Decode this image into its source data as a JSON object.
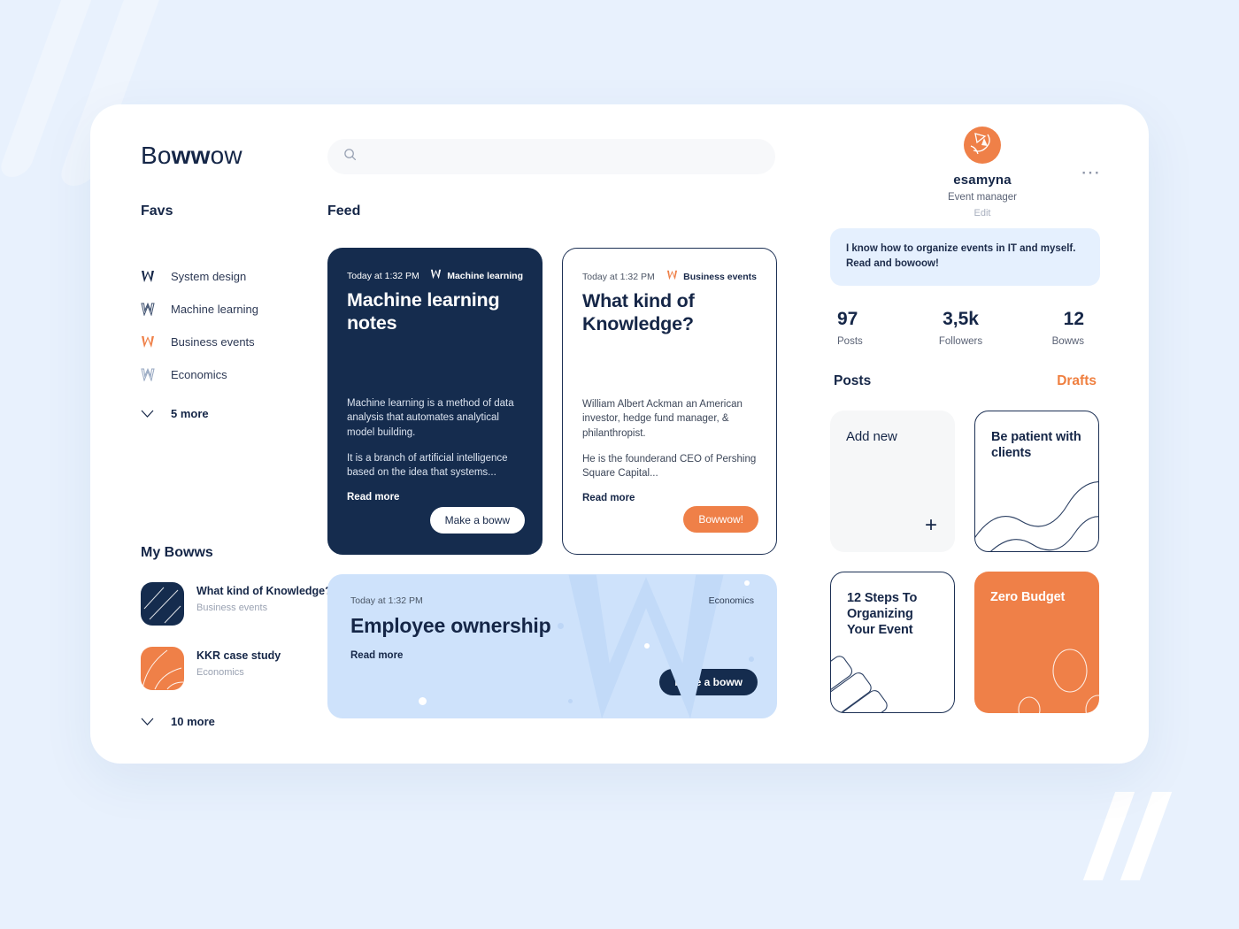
{
  "brand": {
    "name_prefix": "Bo",
    "name_bold": "ww",
    "name_suffix": "ow"
  },
  "search": {
    "value": "",
    "placeholder": "",
    "icon": "search-icon"
  },
  "header": {
    "overflow_icon": "more-horizontal-icon"
  },
  "profile": {
    "avatar_icon": "user-avatar",
    "username": "esamyna",
    "role": "Event manager",
    "edit_label": "Edit",
    "bio": "I know how to organize events in IT and myself. Read and bowoow!",
    "stats": [
      {
        "value": "97",
        "label": "Posts"
      },
      {
        "value": "3,5k",
        "label": "Followers"
      },
      {
        "value": "12",
        "label": "Bowws"
      }
    ],
    "tabs": [
      {
        "label": "Posts",
        "active": false
      },
      {
        "label": "Drafts",
        "active": true
      }
    ],
    "tiles": [
      {
        "title": "Add new",
        "style": "add",
        "icon": "plus-icon"
      },
      {
        "title": "Be patient with clients",
        "style": "outline",
        "icon": "wave-lines-decoration"
      },
      {
        "title": "12 Steps To Organizing Your Event",
        "style": "outline",
        "icon": "stacked-cards-decoration"
      },
      {
        "title": "Zero Budget",
        "style": "orange",
        "icon": "circles-decoration"
      }
    ]
  },
  "sidebar": {
    "favs_title": "Favs",
    "favs": [
      {
        "label": "System design",
        "icon": "bowwow-mark-solid-dark"
      },
      {
        "label": "Machine learning",
        "icon": "bowwow-mark-outline-dark"
      },
      {
        "label": "Business events",
        "icon": "bowwow-mark-solid-orange"
      },
      {
        "label": "Economics",
        "icon": "bowwow-mark-outline-light"
      }
    ],
    "favs_more": {
      "label": "5 more",
      "icon": "chevron-down-icon"
    },
    "bowws_title": "My Bowws",
    "bowws": [
      {
        "title": "What kind of Knowledge?",
        "category": "Business events",
        "thumb": "dark-stripes-thumb"
      },
      {
        "title": "KKR case study",
        "category": "Economics",
        "thumb": "orange-curves-thumb"
      }
    ],
    "bowws_more": {
      "label": "10 more",
      "icon": "chevron-down-icon"
    }
  },
  "feed": {
    "title": "Feed",
    "cards": [
      {
        "time": "Today at 1:32 PM",
        "tag": "Machine learning",
        "tag_icon": "bowwow-mark-white",
        "title": "Machine learning notes",
        "paragraph1": "Machine learning is a method of data analysis that automates analytical model building.",
        "paragraph2": "It is a branch of artificial intelligence based on the idea that systems...",
        "read_more": "Read more",
        "action": "Make a boww",
        "theme": "dark"
      },
      {
        "time": "Today at 1:32 PM",
        "tag": "Business events",
        "tag_icon": "bowwow-mark-orange",
        "title": "What kind of Knowledge?",
        "paragraph1": "William Albert Ackman an American investor, hedge fund manager, & philanthropist.",
        "paragraph2": "He is the founderand CEO of Pershing Square Capital...",
        "read_more": "Read more",
        "action": "Bowwow!",
        "theme": "light"
      }
    ],
    "wide_card": {
      "time": "Today at 1:32 PM",
      "tag": "Economics",
      "title": "Employee ownership",
      "read_more": "Read more",
      "action": "Make a boww"
    }
  },
  "colors": {
    "page_bg": "#e8f1fd",
    "panel": "#ffffff",
    "navy": "#152647",
    "card_dark": "#152c4e",
    "orange": "#ef8048",
    "orange_text": "#ef7f3f",
    "light_blue": "#cee2fb",
    "bio_blue": "#e5f0fe"
  }
}
